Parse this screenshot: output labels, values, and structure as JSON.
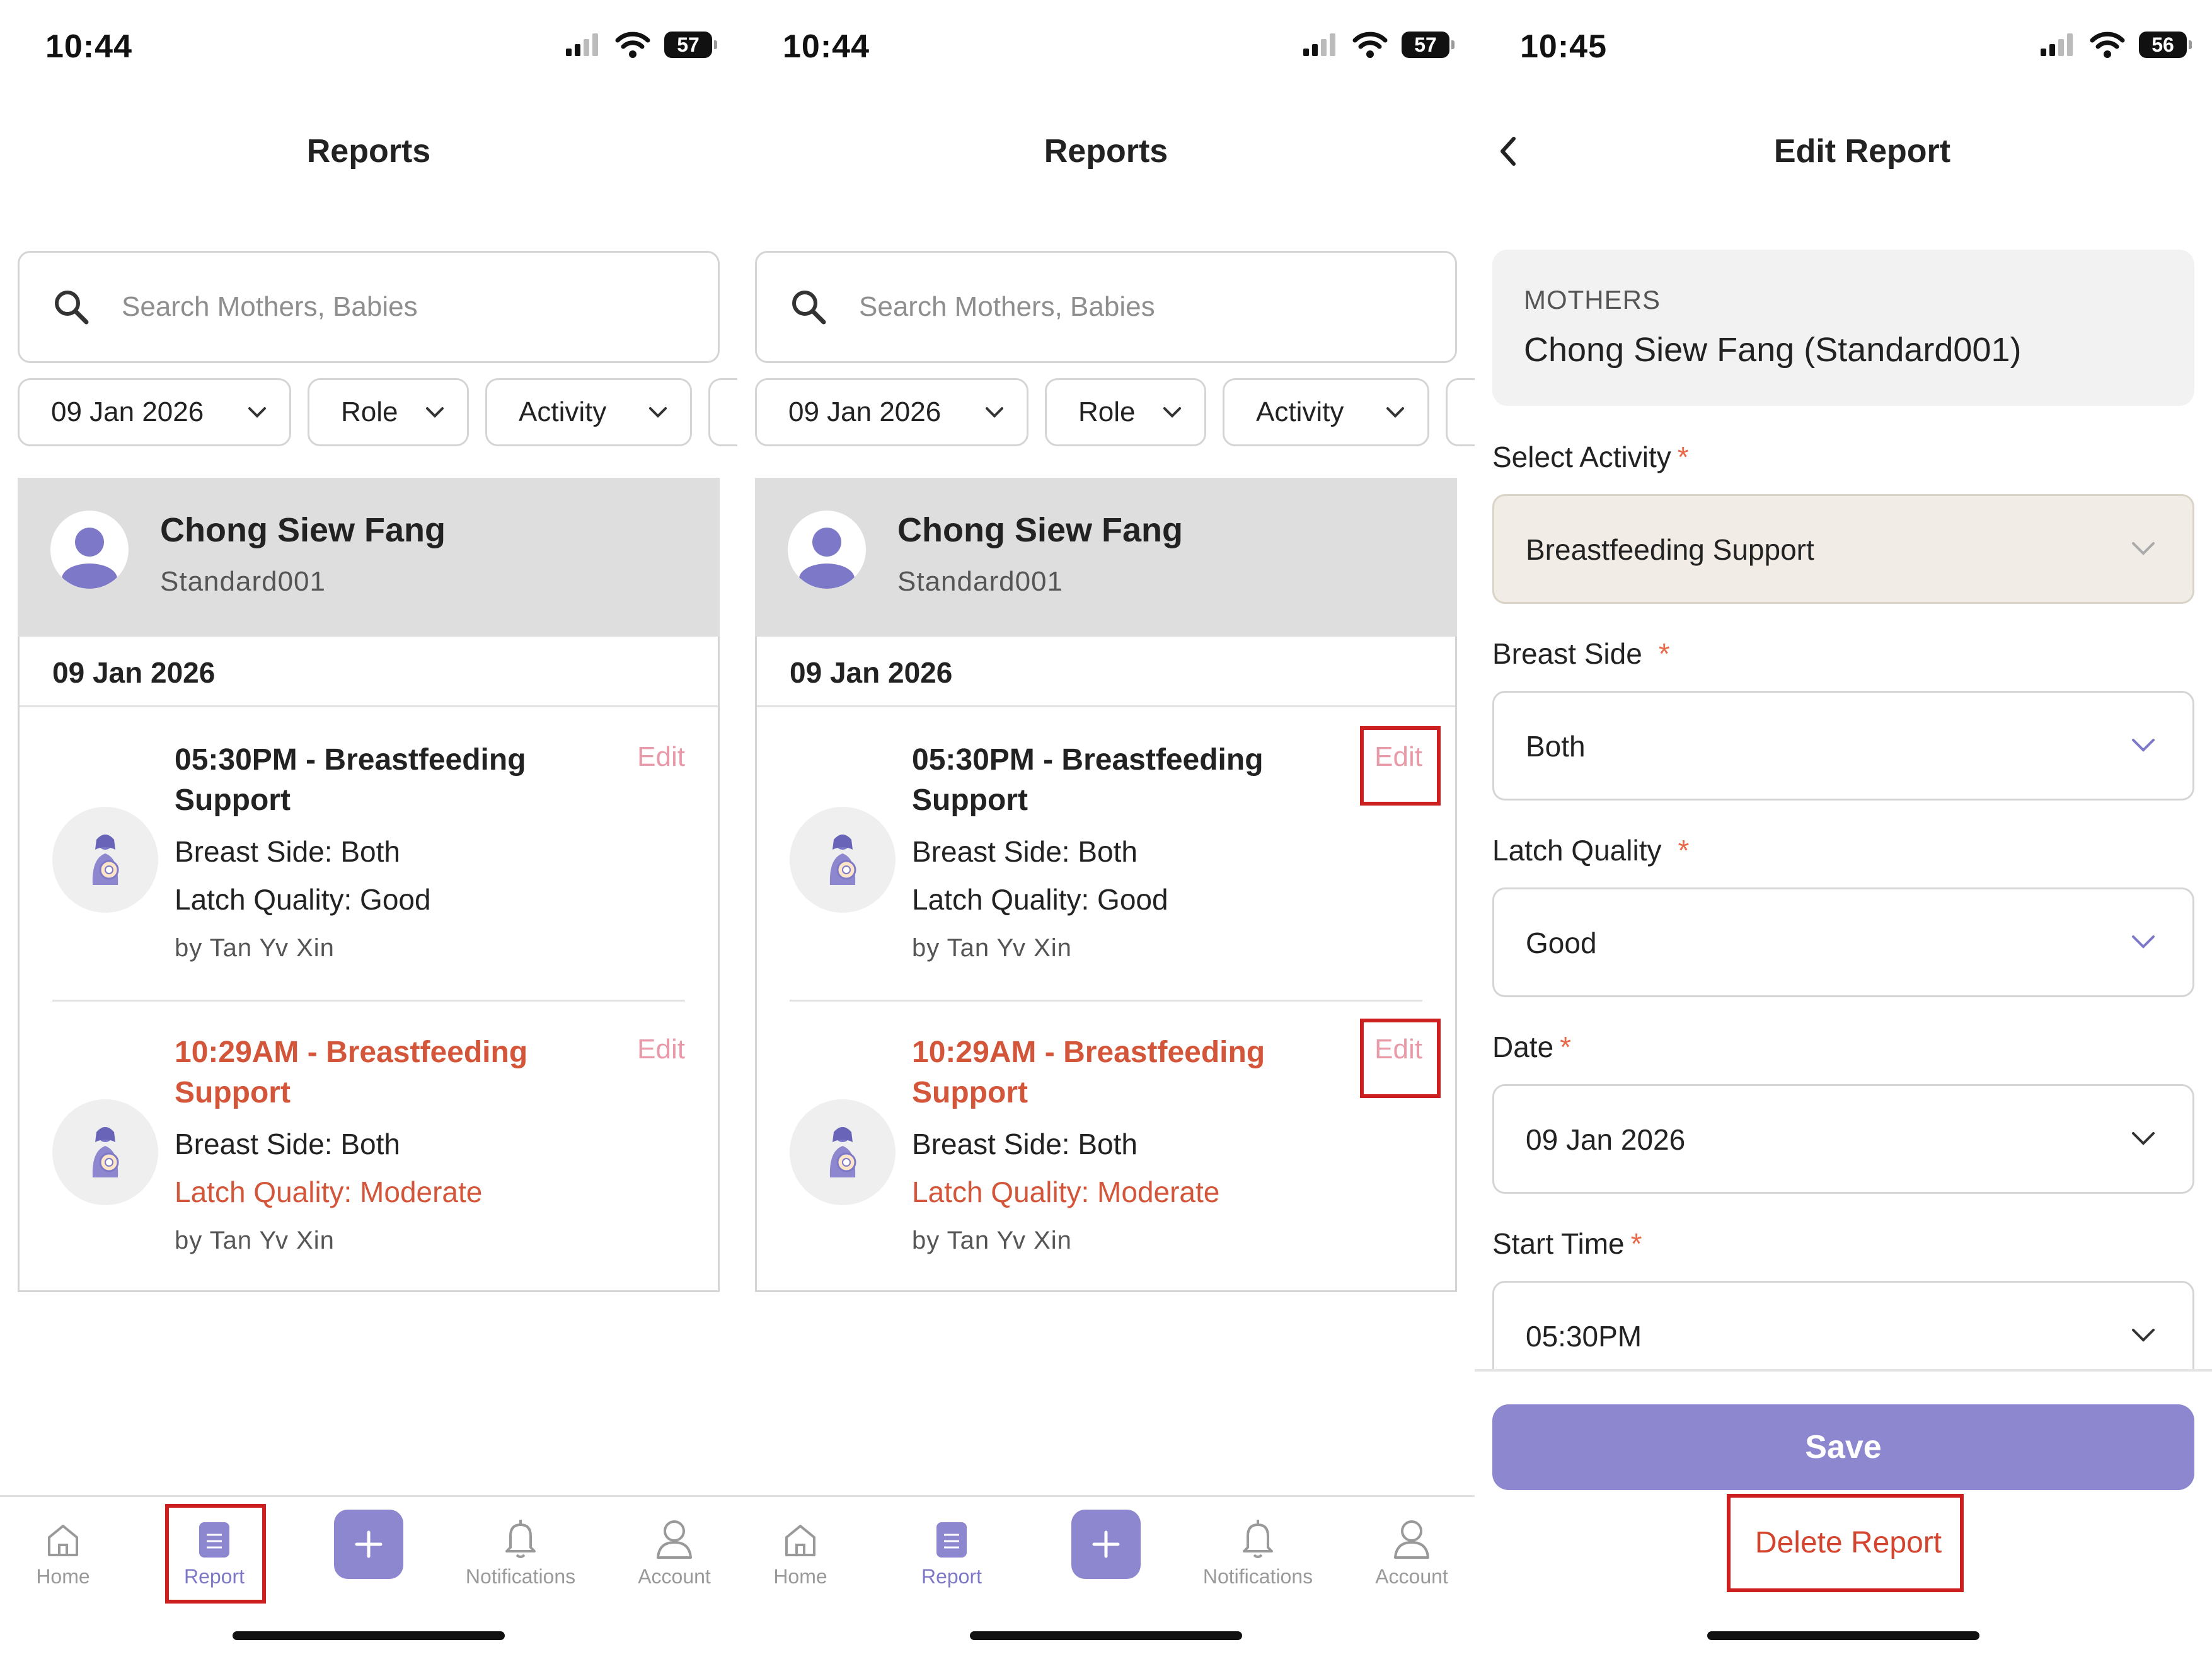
{
  "colors": {
    "accent": "#8c87cf",
    "alert": "#d4563a",
    "edit": "#e89aa8",
    "highlight": "#cc1f1f"
  },
  "screen1": {
    "status": {
      "time": "10:44",
      "battery": "57"
    },
    "title": "Reports",
    "search": {
      "placeholder": "Search Mothers, Babies"
    },
    "filters": {
      "date": "09 Jan 2026",
      "role": "Role",
      "activity": "Activity"
    },
    "mother": {
      "name": "Chong Siew Fang",
      "id": "Standard001"
    },
    "date_header": "09 Jan 2026",
    "entries": [
      {
        "title": "05:30PM - Breastfeeding Support",
        "breast_side": "Breast Side: Both",
        "latch": "Latch Quality: Good",
        "by": "by Tan Yv Xin",
        "edit": "Edit",
        "alert": false
      },
      {
        "title": "10:29AM - Breastfeeding Support",
        "breast_side": "Breast Side: Both",
        "latch": "Latch Quality: Moderate",
        "by": "by Tan Yv Xin",
        "edit": "Edit",
        "alert": true
      }
    ],
    "tabs": {
      "home": "Home",
      "report": "Report",
      "notifications": "Notifications",
      "account": "Account"
    }
  },
  "screen2": {
    "status": {
      "time": "10:44",
      "battery": "57"
    },
    "title": "Reports",
    "search": {
      "placeholder": "Search Mothers, Babies"
    },
    "filters": {
      "date": "09 Jan 2026",
      "role": "Role",
      "activity": "Activity"
    },
    "mother": {
      "name": "Chong Siew Fang",
      "id": "Standard001"
    },
    "date_header": "09 Jan 2026",
    "entries": [
      {
        "title": "05:30PM - Breastfeeding Support",
        "breast_side": "Breast Side: Both",
        "latch": "Latch Quality: Good",
        "by": "by Tan Yv Xin",
        "edit": "Edit",
        "alert": false
      },
      {
        "title": "10:29AM - Breastfeeding Support",
        "breast_side": "Breast Side: Both",
        "latch": "Latch Quality: Moderate",
        "by": "by Tan Yv Xin",
        "edit": "Edit",
        "alert": true
      }
    ],
    "tabs": {
      "home": "Home",
      "report": "Report",
      "notifications": "Notifications",
      "account": "Account"
    }
  },
  "screen3": {
    "status": {
      "time": "10:45",
      "battery": "56"
    },
    "title": "Edit Report",
    "mothers": {
      "label": "MOTHERS",
      "value": "Chong Siew Fang (Standard001)"
    },
    "fields": [
      {
        "label": "Select Activity",
        "value": "Breastfeeding Support"
      },
      {
        "label": "Breast Side",
        "value": "Both"
      },
      {
        "label": "Latch Quality",
        "value": "Good"
      },
      {
        "label": "Date",
        "value": "09 Jan 2026"
      },
      {
        "label": "Start Time",
        "value": "05:30PM"
      }
    ],
    "required_mark": "*",
    "save": "Save",
    "delete": "Delete Report"
  }
}
